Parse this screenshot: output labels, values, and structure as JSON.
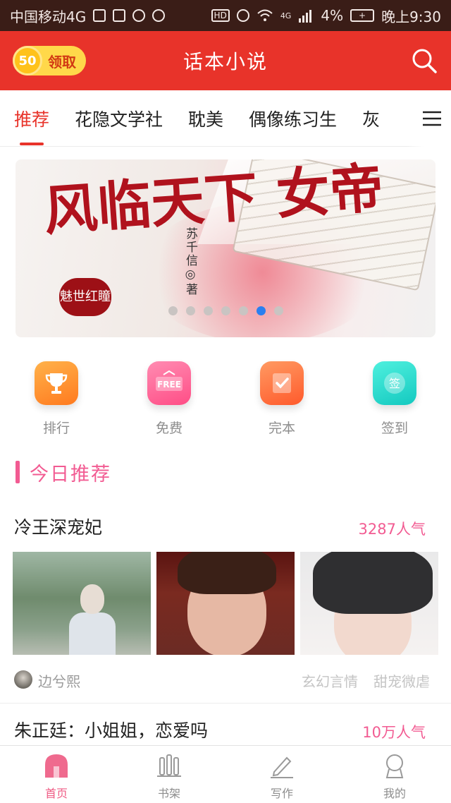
{
  "status_bar": {
    "carrier": "中国移动4G",
    "signal_badge": "4G",
    "battery_percent": "4%",
    "time": "晚上9:30"
  },
  "app_bar": {
    "coin_count": "50",
    "reward_label": "领取",
    "title": "话本小说"
  },
  "tabs": [
    {
      "label": "推荐"
    },
    {
      "label": "花隐文学社"
    },
    {
      "label": "耽美"
    },
    {
      "label": "偶像练习生"
    },
    {
      "label": "灰"
    }
  ],
  "banner": {
    "calligraphy": "风临天下 女帝",
    "seal_text": "魅世红瞳",
    "author": "苏千信◎著",
    "slide_count": 7,
    "active_slide": 6
  },
  "quick_actions": [
    {
      "label": "排行",
      "icon": "trophy-icon"
    },
    {
      "label": "免费",
      "icon": "free-tag-icon",
      "badge": "FREE"
    },
    {
      "label": "完本",
      "icon": "check-note-icon"
    },
    {
      "label": "签到",
      "icon": "sign-in-icon",
      "badge": "签"
    }
  ],
  "section": {
    "title": "今日推荐"
  },
  "feed": [
    {
      "title": "冷王深宠妃",
      "popularity": "3287人气",
      "author": "边兮熙",
      "tags": [
        "玄幻言情",
        "甜宠微虐"
      ]
    },
    {
      "title": "朱正廷：小姐姐，恋爱吗",
      "popularity": "10万人气"
    }
  ],
  "bottom_nav": [
    {
      "label": "首页",
      "icon": "home-icon"
    },
    {
      "label": "书架",
      "icon": "bookshelf-icon"
    },
    {
      "label": "写作",
      "icon": "pen-icon"
    },
    {
      "label": "我的",
      "icon": "profile-icon"
    }
  ],
  "colors": {
    "brand_red": "#e8332a",
    "pink_accent": "#f25b92",
    "carousel_active_dot": "#2a7ff0",
    "status_bar_bg": "#3a1d17"
  }
}
